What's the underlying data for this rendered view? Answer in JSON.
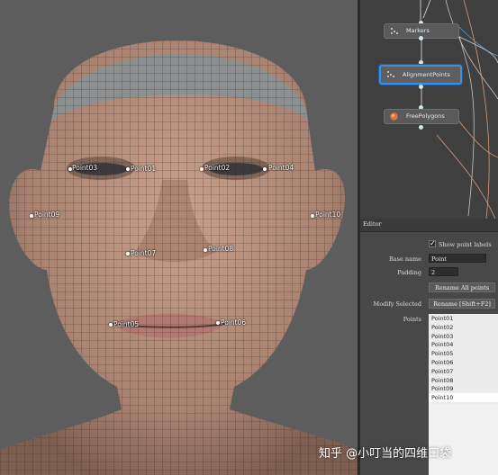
{
  "viewport": {
    "landmarks": [
      {
        "label": "Point03"
      },
      {
        "label": "Point01"
      },
      {
        "label": "Point02"
      },
      {
        "label": "Point04"
      },
      {
        "label": "Point09"
      },
      {
        "label": "Point10"
      },
      {
        "label": "Point07"
      },
      {
        "label": "Point08"
      },
      {
        "label": "Point05"
      },
      {
        "label": "Point06"
      }
    ]
  },
  "node_graph": {
    "nodes": [
      {
        "label": "Markers",
        "icon": "markers-icon"
      },
      {
        "label": "AlignmentPoints",
        "icon": "points-icon",
        "selected": true
      },
      {
        "label": "FreePolygons",
        "icon": "polygons-icon"
      }
    ],
    "accent_color": "#3d8fe0"
  },
  "editor": {
    "title": "Editor",
    "show_point_labels": {
      "label": "Show point labels",
      "checked": true
    },
    "base_name": {
      "label": "Base name",
      "value": "Point"
    },
    "padding": {
      "label": "Padding",
      "value": "2"
    },
    "rename_all_button": "Rename All points",
    "modify_selected": {
      "label": "Modify Selected",
      "button": "Rename [Shift+F2]"
    },
    "points": {
      "label": "Points",
      "items": [
        "Point01",
        "Point02",
        "Point03",
        "Point04",
        "Point05",
        "Point06",
        "Point07",
        "Point08",
        "Point09",
        "Point10"
      ],
      "selected": "Point10"
    }
  },
  "watermark": "知乎 @小叮当的四维口袋"
}
